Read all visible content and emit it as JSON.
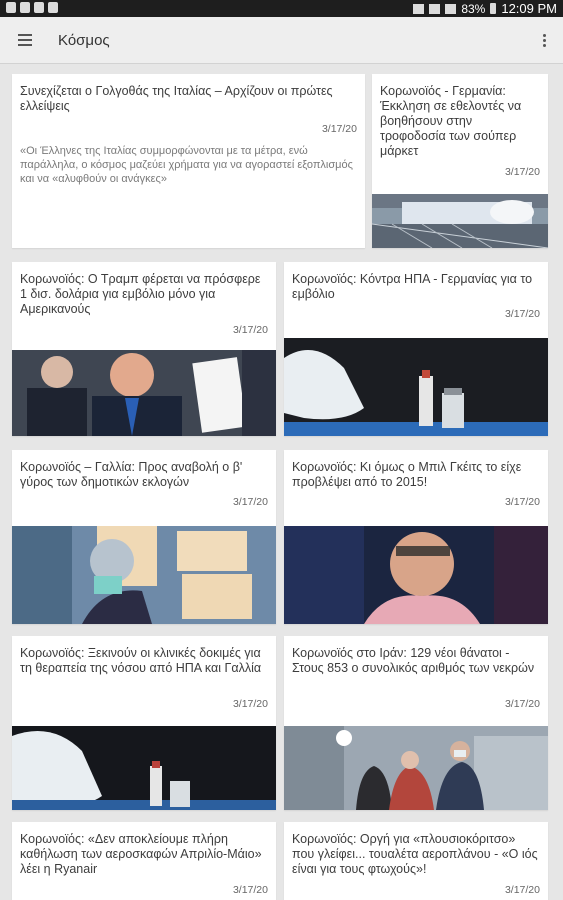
{
  "status": {
    "battery": "83%",
    "time": "12:09 PM"
  },
  "header": {
    "title": "Κόσμος"
  },
  "cards": [
    {
      "title": "Συνεχίζεται ο Γολγοθάς της Ιταλίας – Αρχίζουν οι πρώτες ελλείψεις",
      "date": "3/17/20",
      "snippet": "«Οι Έλληνες της Ιταλίας συμμορφώνονται με τα μέτρα, ενώ παράλληλα, ο κόσμος μαζεύει χρήματα για να αγοραστεί εξοπλισμός και να «αλυφθούν οι ανάγκες»"
    },
    {
      "title": "Κορωνοϊός - Γερμανία: Έκκληση σε εθελοντές να βοηθήσουν στην τροφοδοσία των σούπερ μάρκετ",
      "date": "3/17/20"
    },
    {
      "title": "Κορωνοϊός: Ο Τραμπ φέρεται να πρόσφερε 1 δισ. δολάρια για εμβόλιο μόνο για Αμερικανούς",
      "date": "3/17/20"
    },
    {
      "title": "Κορωνοϊός: Κόντρα ΗΠΑ - Γερμανίας για το εμβόλιο",
      "date": "3/17/20"
    },
    {
      "title": "Κορωνοϊός – Γαλλία: Προς αναβολή ο β' γύρος των δημοτικών εκλογών",
      "date": "3/17/20"
    },
    {
      "title": "Κορωνοϊός: Κι όμως ο Μπιλ Γκέιτς το είχε προβλέψει από το 2015!",
      "date": "3/17/20"
    },
    {
      "title": "Κορωνοϊός: Ξεκινούν οι κλινικές δοκιμές για τη θεραπεία της νόσου από ΗΠΑ και Γαλλία",
      "date": "3/17/20"
    },
    {
      "title": "Κορωνοϊός στο Ιράν: 129 νέοι θάνατοι - Στους 853 ο συνολικός αριθμός των νεκρών",
      "date": "3/17/20"
    },
    {
      "title": "Κορωνοϊός: «Δεν αποκλείουμε πλήρη καθήλωση των αεροσκαφών Απριλίο-Μάιο» λέει η Ryanair",
      "date": "3/17/20"
    },
    {
      "title": "Κορωνοϊός: Οργή για «πλουσιοκόριτσο» που γλείφει... τουαλέτα αεροπλάνου - «Ο ιός είναι για τους φτωχούς»!",
      "date": "3/17/20"
    }
  ]
}
